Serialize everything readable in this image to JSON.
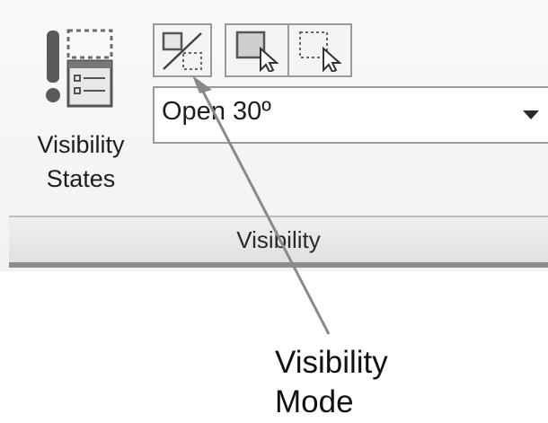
{
  "ribbon": {
    "big_button": {
      "label_line1": "Visibility",
      "label_line2": "States",
      "icon": "visibility-states-icon"
    },
    "tools": {
      "mode_icon": "visibility-mode-icon",
      "select_icon": "make-visible-select-icon",
      "select_hidden_icon": "make-invisible-select-icon"
    },
    "dropdown": {
      "value": "Open 30º",
      "icon": "chevron-down-icon"
    },
    "panel_title": "Visibility"
  },
  "callout": {
    "line1": "Visibility",
    "line2": "Mode"
  },
  "colors": {
    "panel_bg": "#f4f4f4",
    "border": "#9a9a9a",
    "arrow": "#8a8a8a"
  }
}
